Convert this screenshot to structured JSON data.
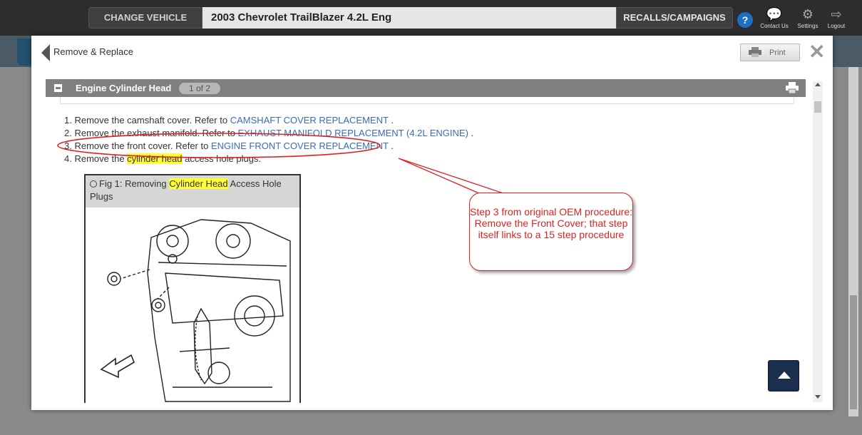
{
  "topbar": {
    "change_vehicle": "CHANGE VEHICLE",
    "vehicle": "2003 Chevrolet TrailBlazer 4.2L Eng",
    "recalls": "RECALLS/CAMPAIGNS",
    "help": "?",
    "contact_label": "Contact Us",
    "settings_label": "Settings",
    "logout_label": "Logout"
  },
  "modal": {
    "title": "Remove & Replace",
    "print_label": "Print",
    "close_glyph": "✕"
  },
  "section": {
    "title": "Engine Cylinder Head",
    "page_badge": "1 of 2"
  },
  "steps": [
    {
      "num": "1.",
      "text": "Remove the camshaft cover. Refer to ",
      "link": "CAMSHAFT COVER REPLACEMENT",
      "tail": " ."
    },
    {
      "num": "2.",
      "text": "Remove the exhaust manifold. Refer to ",
      "link": "EXHAUST MANIFOLD REPLACEMENT (4.2L ENGINE)",
      "tail": " ."
    },
    {
      "num": "3.",
      "text": "Remove the front cover. Refer to ",
      "link": "ENGINE FRONT COVER REPLACEMENT",
      "tail": " ."
    },
    {
      "num": "4.",
      "text_before": "Remove the ",
      "highlight": "cylinder head",
      "text_after": " access hole plugs."
    }
  ],
  "figure": {
    "prefix": "Fig 1: Removing ",
    "highlight": "Cylinder Head",
    "suffix": " Access Hole Plugs"
  },
  "callout": {
    "text": "Step 3 from original OEM procedure: Remove the Front Cover; that step itself links to a 15 step procedure"
  },
  "colors": {
    "link": "#3a6cb0",
    "annotation": "#d22222",
    "highlight": "#ffff33",
    "section_header": "#808080"
  }
}
